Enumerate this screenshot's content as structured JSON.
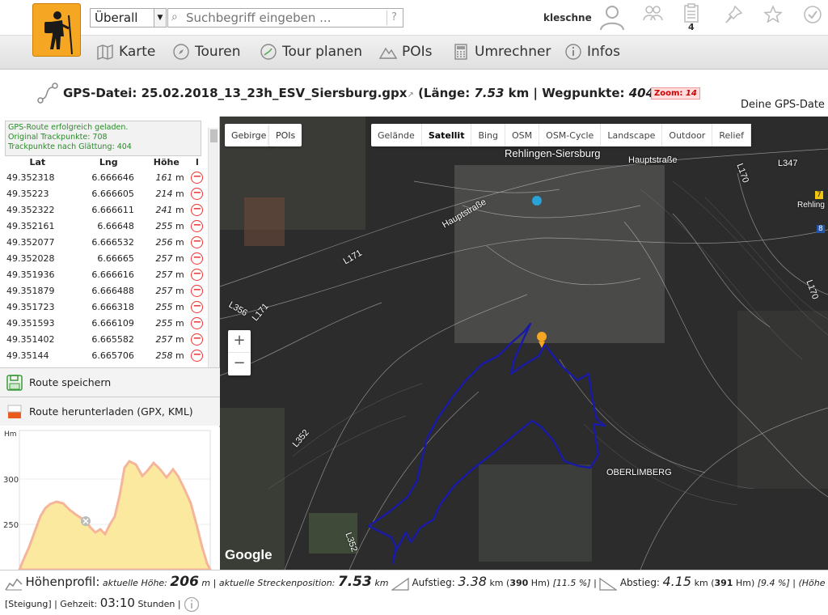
{
  "header": {
    "scope_select": "Überall",
    "search_placeholder": "Suchbegriff eingeben ...",
    "help": "?",
    "username": "kleschne",
    "list_badge": "4"
  },
  "nav": {
    "items": [
      {
        "label": "Karte",
        "icon": "map-icon"
      },
      {
        "label": "Touren",
        "icon": "compass-icon"
      },
      {
        "label": "Tour planen",
        "icon": "route-plan-icon"
      },
      {
        "label": "POIs",
        "icon": "mountain-icon"
      },
      {
        "label": "Umrechner",
        "icon": "calculator-icon"
      },
      {
        "label": "Infos",
        "icon": "info-icon"
      }
    ]
  },
  "gps": {
    "prefix": "GPS-Datei: ",
    "filename": "25.02.2018_13_23h_ESV_Siersburg.gpx",
    "length_label": " (Länge: ",
    "length_value": "7.53",
    "length_unit": " km | Wegpunkte: ",
    "waypoints": "404",
    "close": " )",
    "zoom_label": "Zoom: ",
    "zoom_value": "14",
    "deine": "Deine GPS-Date"
  },
  "status": {
    "line1": "GPS-Route erfolgreich geladen.",
    "line2": "Original Trackpunkte: 708",
    "line3": "Trackpunkte nach Glättung: 404"
  },
  "trackpoints": {
    "headers": [
      "Lat",
      "Lng",
      "Höhe",
      "l"
    ],
    "rows": [
      {
        "lat": "49.352318",
        "lng": "6.666646",
        "h": "161",
        "u": "m"
      },
      {
        "lat": "49.35223",
        "lng": "6.666605",
        "h": "214",
        "u": "m"
      },
      {
        "lat": "49.352322",
        "lng": "6.666611",
        "h": "241",
        "u": "m"
      },
      {
        "lat": "49.352161",
        "lng": "6.66648",
        "h": "255",
        "u": "m"
      },
      {
        "lat": "49.352077",
        "lng": "6.666532",
        "h": "256",
        "u": "m"
      },
      {
        "lat": "49.352028",
        "lng": "6.66665",
        "h": "257",
        "u": "m"
      },
      {
        "lat": "49.351936",
        "lng": "6.666616",
        "h": "257",
        "u": "m"
      },
      {
        "lat": "49.351879",
        "lng": "6.666488",
        "h": "257",
        "u": "m"
      },
      {
        "lat": "49.351723",
        "lng": "6.666318",
        "h": "255",
        "u": "m"
      },
      {
        "lat": "49.351593",
        "lng": "6.666109",
        "h": "255",
        "u": "m"
      },
      {
        "lat": "49.351402",
        "lng": "6.665582",
        "h": "257",
        "u": "m"
      },
      {
        "lat": "49.35144",
        "lng": "6.665706",
        "h": "258",
        "u": "m"
      }
    ]
  },
  "actions": {
    "save": "Route speichern",
    "download": "Route herunterladen (GPX, KML)"
  },
  "profile_chart": {
    "y_unit": "Hm",
    "ticks": [
      "300",
      "250"
    ]
  },
  "map": {
    "buttons": [
      "Gebirge",
      "POIs"
    ],
    "types": [
      "Gelände",
      "Satellit",
      "Bing",
      "OSM",
      "OSM-Cycle",
      "Landscape",
      "Outdoor",
      "Relief"
    ],
    "active_type": "Satellit",
    "zoom_in": "+",
    "zoom_out": "−",
    "google": "Google",
    "labels": {
      "town": "Rehlingen-Siersburg",
      "hauptstrasse1": "Hauptstraße",
      "hauptstrasse2": "Hauptstraße",
      "l171": "L171",
      "l171b": "L171",
      "l356": "L356",
      "l352": "L352",
      "l352b": "L352",
      "l347": "L347",
      "l170": "L170",
      "l170b": "L170",
      "oberlimberg": "OBERLIMBERG",
      "rehling": "Rehling",
      "seven": "7",
      "eight": "8"
    },
    "track_color": "#1a1aa8"
  },
  "bottom": {
    "profile_label": "Höhenprofil:",
    "current_height_label": "aktuelle Höhe:",
    "current_height": "206",
    "current_height_unit": "m",
    "position_label": "| aktuelle Streckenposition:",
    "position": "7.53",
    "position_unit": "km",
    "ascent_label": "Aufstieg:",
    "ascent": "3.38",
    "ascent_unit": "km",
    "ascent_hm": "390",
    "ascent_pct": "[11.5 %] |",
    "descent_label": "Abstieg:",
    "descent": "4.15",
    "descent_unit": "km",
    "descent_hm": "391",
    "descent_pct": "[9.4 %] | (Höhe",
    "steigung": "[Steigung] | Gehzeit:",
    "gehzeit": "03:10",
    "stunden": "Stunden |"
  }
}
